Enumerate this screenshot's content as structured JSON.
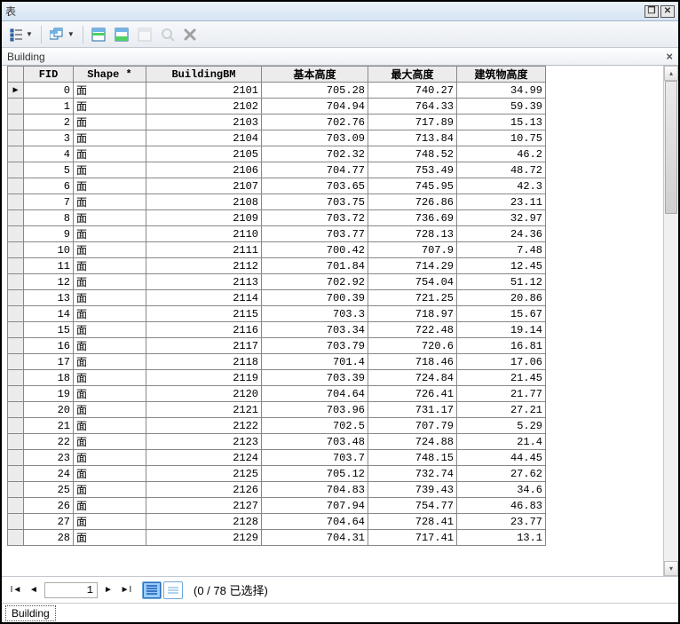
{
  "window": {
    "title": "表"
  },
  "subheader": {
    "title": "Building"
  },
  "columns": {
    "rowhead": "",
    "fid": "FID",
    "shape": "Shape *",
    "bm": "BuildingBM",
    "base": "基本高度",
    "max": "最大高度",
    "height": "建筑物高度"
  },
  "chart_data": {
    "type": "table",
    "title": "Building",
    "columns": [
      "FID",
      "Shape *",
      "BuildingBM",
      "基本高度",
      "最大高度",
      "建筑物高度"
    ],
    "rows": [
      {
        "fid": 0,
        "shape": "面",
        "bm": 2101,
        "base": 705.28,
        "max": 740.27,
        "height": 34.99
      },
      {
        "fid": 1,
        "shape": "面",
        "bm": 2102,
        "base": 704.94,
        "max": 764.33,
        "height": 59.39
      },
      {
        "fid": 2,
        "shape": "面",
        "bm": 2103,
        "base": 702.76,
        "max": 717.89,
        "height": 15.13
      },
      {
        "fid": 3,
        "shape": "面",
        "bm": 2104,
        "base": 703.09,
        "max": 713.84,
        "height": 10.75
      },
      {
        "fid": 4,
        "shape": "面",
        "bm": 2105,
        "base": 702.32,
        "max": 748.52,
        "height": 46.2
      },
      {
        "fid": 5,
        "shape": "面",
        "bm": 2106,
        "base": 704.77,
        "max": 753.49,
        "height": 48.72
      },
      {
        "fid": 6,
        "shape": "面",
        "bm": 2107,
        "base": 703.65,
        "max": 745.95,
        "height": 42.3
      },
      {
        "fid": 7,
        "shape": "面",
        "bm": 2108,
        "base": 703.75,
        "max": 726.86,
        "height": 23.11
      },
      {
        "fid": 8,
        "shape": "面",
        "bm": 2109,
        "base": 703.72,
        "max": 736.69,
        "height": 32.97
      },
      {
        "fid": 9,
        "shape": "面",
        "bm": 2110,
        "base": 703.77,
        "max": 728.13,
        "height": 24.36
      },
      {
        "fid": 10,
        "shape": "面",
        "bm": 2111,
        "base": 700.42,
        "max": 707.9,
        "height": 7.48
      },
      {
        "fid": 11,
        "shape": "面",
        "bm": 2112,
        "base": 701.84,
        "max": 714.29,
        "height": 12.45
      },
      {
        "fid": 12,
        "shape": "面",
        "bm": 2113,
        "base": 702.92,
        "max": 754.04,
        "height": 51.12
      },
      {
        "fid": 13,
        "shape": "面",
        "bm": 2114,
        "base": 700.39,
        "max": 721.25,
        "height": 20.86
      },
      {
        "fid": 14,
        "shape": "面",
        "bm": 2115,
        "base": 703.3,
        "max": 718.97,
        "height": 15.67
      },
      {
        "fid": 15,
        "shape": "面",
        "bm": 2116,
        "base": 703.34,
        "max": 722.48,
        "height": 19.14
      },
      {
        "fid": 16,
        "shape": "面",
        "bm": 2117,
        "base": 703.79,
        "max": 720.6,
        "height": 16.81
      },
      {
        "fid": 17,
        "shape": "面",
        "bm": 2118,
        "base": 701.4,
        "max": 718.46,
        "height": 17.06
      },
      {
        "fid": 18,
        "shape": "面",
        "bm": 2119,
        "base": 703.39,
        "max": 724.84,
        "height": 21.45
      },
      {
        "fid": 19,
        "shape": "面",
        "bm": 2120,
        "base": 704.64,
        "max": 726.41,
        "height": 21.77
      },
      {
        "fid": 20,
        "shape": "面",
        "bm": 2121,
        "base": 703.96,
        "max": 731.17,
        "height": 27.21
      },
      {
        "fid": 21,
        "shape": "面",
        "bm": 2122,
        "base": 702.5,
        "max": 707.79,
        "height": 5.29
      },
      {
        "fid": 22,
        "shape": "面",
        "bm": 2123,
        "base": 703.48,
        "max": 724.88,
        "height": 21.4
      },
      {
        "fid": 23,
        "shape": "面",
        "bm": 2124,
        "base": 703.7,
        "max": 748.15,
        "height": 44.45
      },
      {
        "fid": 24,
        "shape": "面",
        "bm": 2125,
        "base": 705.12,
        "max": 732.74,
        "height": 27.62
      },
      {
        "fid": 25,
        "shape": "面",
        "bm": 2126,
        "base": 704.83,
        "max": 739.43,
        "height": 34.6
      },
      {
        "fid": 26,
        "shape": "面",
        "bm": 2127,
        "base": 707.94,
        "max": 754.77,
        "height": 46.83
      },
      {
        "fid": 27,
        "shape": "面",
        "bm": 2128,
        "base": 704.64,
        "max": 728.41,
        "height": 23.77
      },
      {
        "fid": 28,
        "shape": "面",
        "bm": 2129,
        "base": 704.31,
        "max": 717.41,
        "height": 13.1
      }
    ]
  },
  "nav": {
    "record": "1",
    "selection_text": "(0 / 78 已选择)"
  },
  "tab": {
    "label": "Building"
  }
}
